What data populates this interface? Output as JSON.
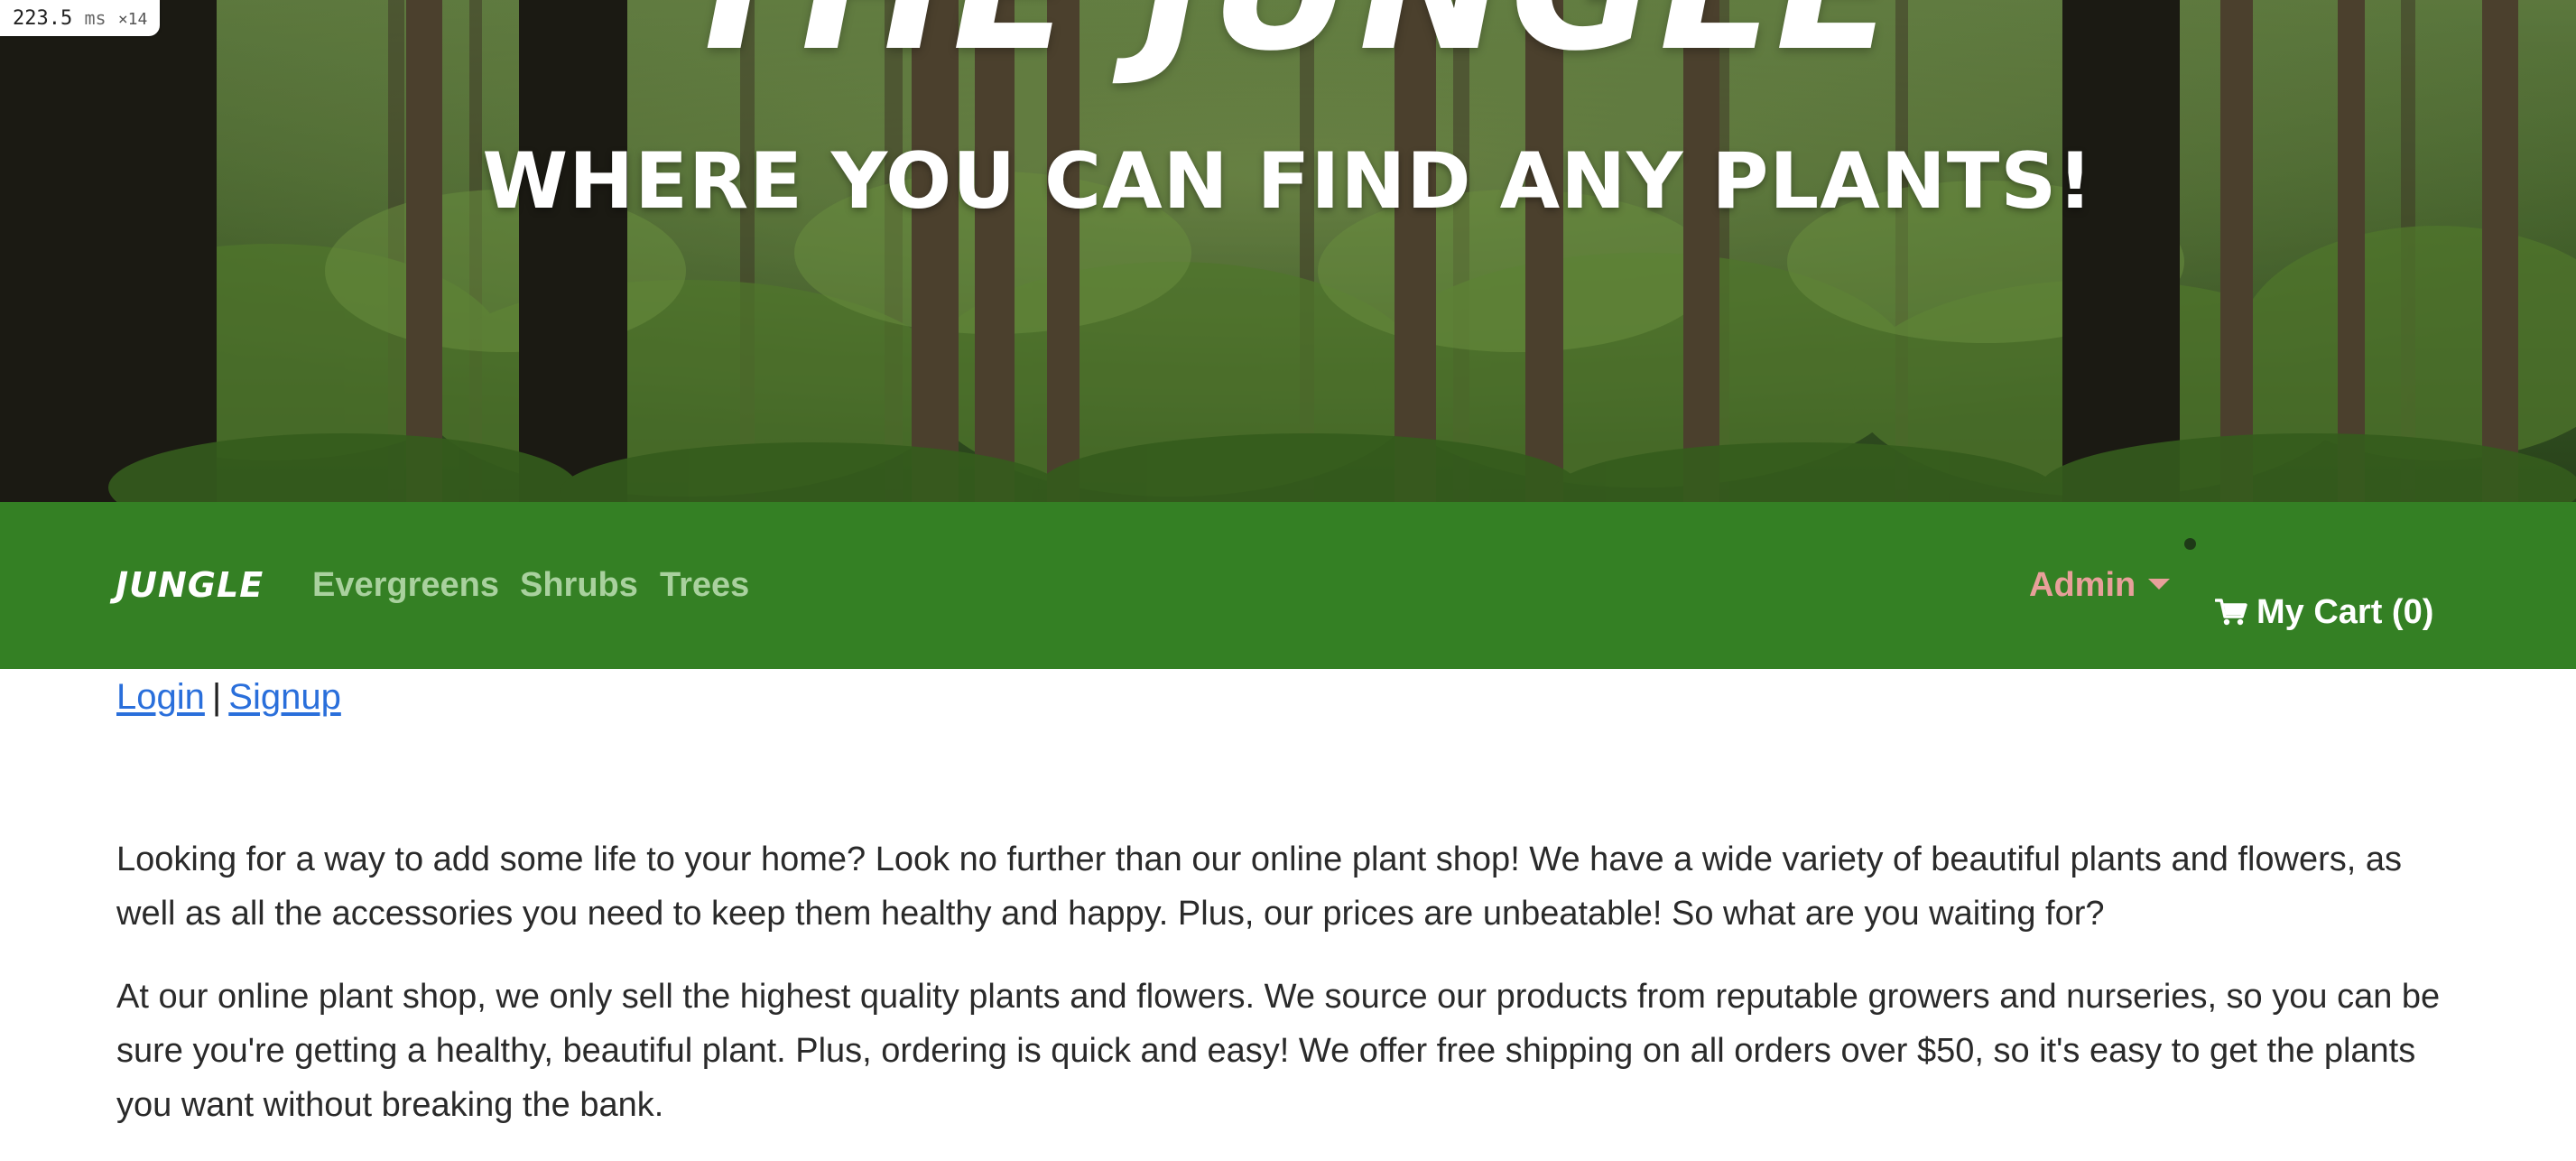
{
  "perf": {
    "value": "223.5",
    "unit": "ms",
    "multiplier": "×14"
  },
  "hero": {
    "title": "THE JUNGLE",
    "subtitle": "WHERE YOU CAN FIND ANY PLANTS!"
  },
  "nav": {
    "brand": "JUNGLE",
    "links": [
      "Evergreens",
      "Shrubs",
      "Trees"
    ],
    "admin_label": "Admin",
    "cart_label": "My Cart (0)"
  },
  "auth": {
    "login": "Login",
    "separator": "|",
    "signup": "Signup"
  },
  "content": {
    "paragraphs": [
      "Looking for a way to add some life to your home? Look no further than our online plant shop! We have a wide variety of beautiful plants and flowers, as well as all the accessories you need to keep them healthy and happy. Plus, our prices are unbeatable! So what are you waiting for?",
      "At our online plant shop, we only sell the highest quality plants and flowers. We source our products from reputable growers and nurseries, so you can be sure you're getting a healthy, beautiful plant. Plus, ordering is quick and easy! We offer free shipping on all orders over $50, so it's easy to get the plants you want without breaking the bank."
    ]
  },
  "icons": {
    "cart": "shopping-cart-icon",
    "admin_caret": "caret-down-icon"
  },
  "colors": {
    "navbar_bg": "#348024",
    "nav_link": "#a9d19e",
    "admin": "#e8a09a",
    "link": "#2a6fdb",
    "hero_text": "#ffffff"
  }
}
